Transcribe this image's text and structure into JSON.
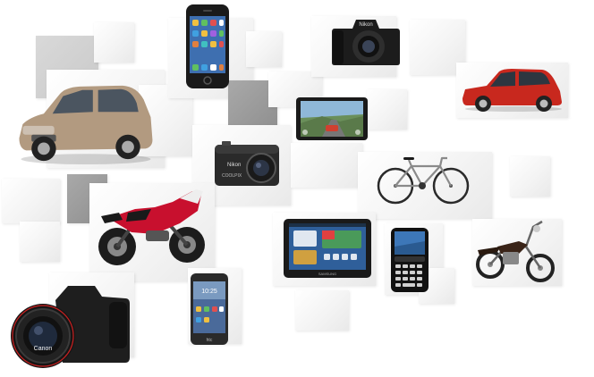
{
  "scene": {
    "background_color": "#ffffff",
    "tile_colors": [
      "#f4f4f4",
      "#c9c9c9",
      "#8f8f8f"
    ]
  },
  "products": [
    {
      "id": "hatchback-car",
      "icon": "car-icon",
      "color": "#b29a80"
    },
    {
      "id": "smartphone-iphone",
      "icon": "smartphone-icon",
      "color": "#1a1a1a"
    },
    {
      "id": "dslr-camera-top",
      "icon": "camera-icon",
      "color": "#1c1c1c",
      "brand_text": "Nikon"
    },
    {
      "id": "red-hatchback-car",
      "icon": "car-icon",
      "color": "#c8281e"
    },
    {
      "id": "tablet-game",
      "icon": "tablet-icon",
      "color": "#1a1a1a"
    },
    {
      "id": "compact-camera",
      "icon": "camera-icon",
      "color": "#2a2a2a",
      "brand_text": "Nikon",
      "model_text": "COOLPIX"
    },
    {
      "id": "bicycle",
      "icon": "bicycle-icon",
      "color": "#2a2a2a"
    },
    {
      "id": "sport-motorcycle",
      "icon": "motorcycle-icon",
      "color": "#c8102e"
    },
    {
      "id": "tablet-home",
      "icon": "tablet-icon",
      "color": "#1a1a1a",
      "brand_text": "SAMSUNG"
    },
    {
      "id": "blackberry-phone",
      "icon": "phone-icon",
      "color": "#111111"
    },
    {
      "id": "classic-motorcycle",
      "icon": "motorcycle-icon",
      "color": "#3a2418"
    },
    {
      "id": "dslr-camera-front",
      "icon": "camera-icon",
      "color": "#151515",
      "brand_text": "Canon"
    },
    {
      "id": "htc-phone",
      "icon": "smartphone-icon",
      "color": "#2a2a2a",
      "brand_text": "htc"
    }
  ]
}
